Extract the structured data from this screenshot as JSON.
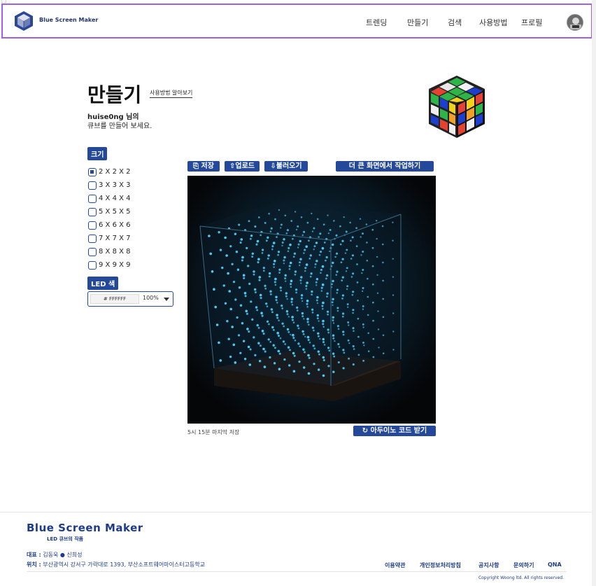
{
  "stray": "└ ┘ ·",
  "header": {
    "brand": "Blue Screen Maker",
    "nav": [
      "트렌딩",
      "만들기",
      "검색",
      "사용방법",
      "프로필"
    ]
  },
  "main": {
    "title": "만들기",
    "guide_link": "사용방법 알아보기",
    "greeting_line1": "huise0ng 님의",
    "greeting_line2": "큐브를 만들어 보세요.",
    "size_tag": "크기",
    "sizes": [
      "2 X 2 X 2",
      "3 X 3 X 3",
      "4 X 4 X 4",
      "5 X 5 X 5",
      "6 X 6 X 6",
      "7 X 7 X 7",
      "8 X 8 X 8",
      "9 X 9 X 9"
    ],
    "selected_size": "2 X 2 X 2",
    "led_tag": "LED 색",
    "led_hex": "# FFFFFF",
    "led_opacity": "100%",
    "buttons": {
      "save": "저장",
      "upload": "업로드",
      "load": "불러오기",
      "bigger": "더 큰 화면에서 작업하기",
      "arduino": "아두이노 코드 받기"
    },
    "last_save": "5시 15분 마지막 저장",
    "led_color": "#4fd6ff",
    "accent": "#24499b"
  },
  "footer": {
    "brand": "Blue Screen Maker",
    "subtitle": "LED 큐브의 작품",
    "rep_label": "대표 :",
    "rep_value": "김동욱 ● 신희성",
    "loc_label": "위치 :",
    "loc_value": "부산광역시 강서구 가락대로 1393, 부산소프트웨어마이스터고등학교",
    "links": [
      "이용약관",
      "개인정보처리방침",
      "공지사항",
      "문의하기",
      "QNA"
    ],
    "copyright": "Copyright Woong ltd. All rights reserved."
  }
}
